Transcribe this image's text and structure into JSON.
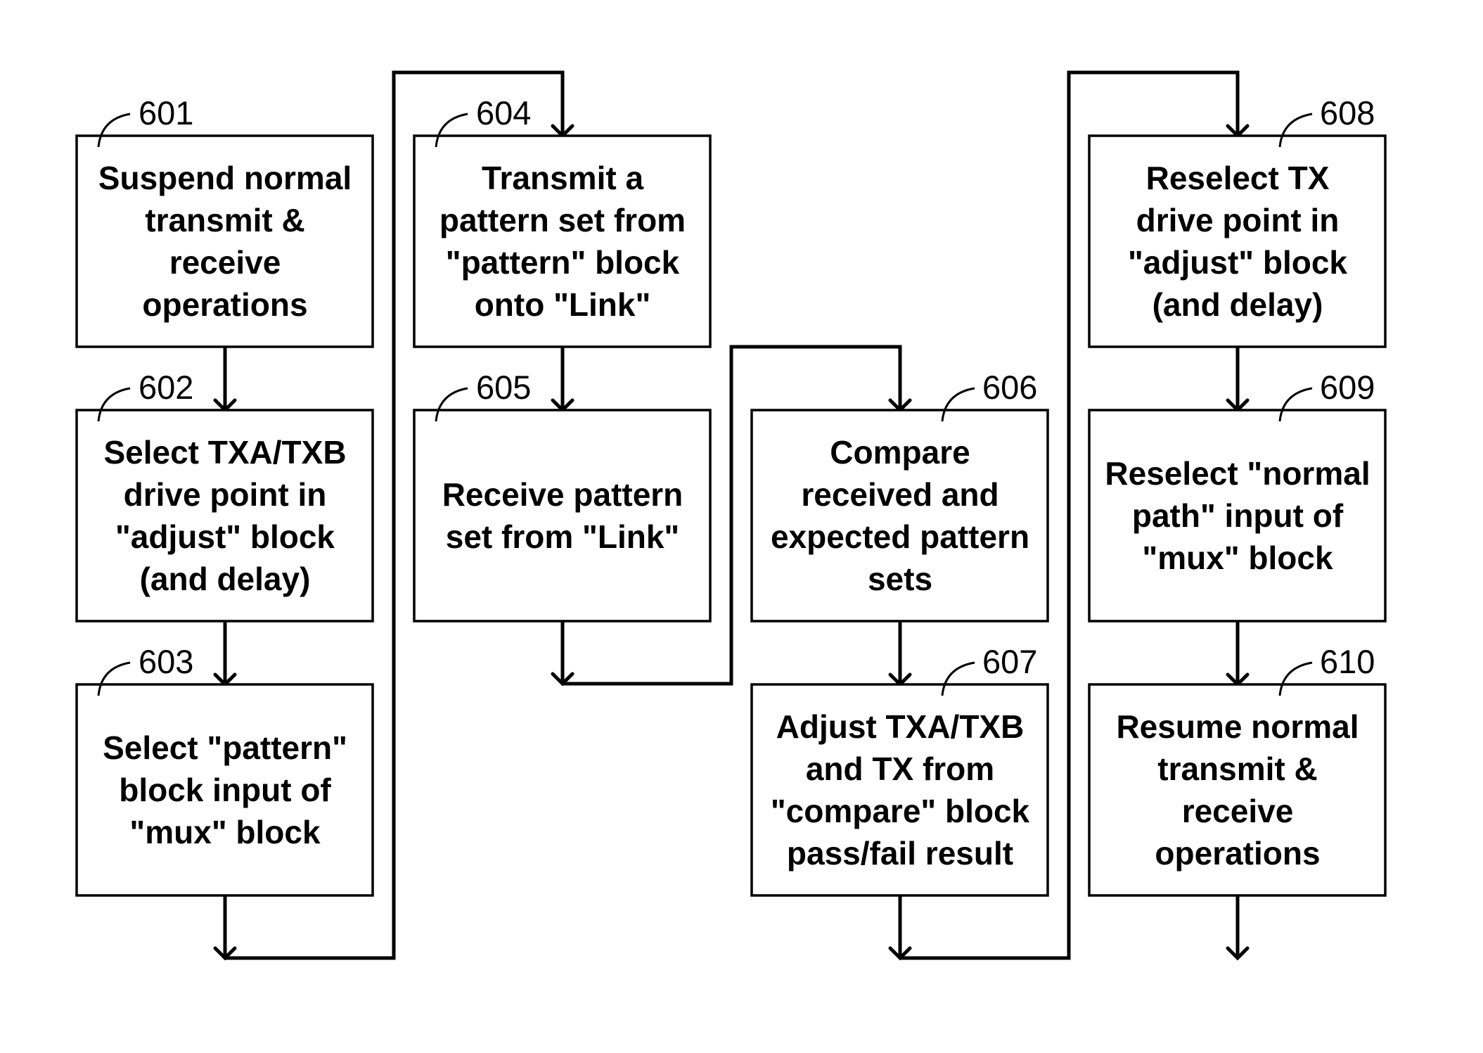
{
  "diagram": {
    "type": "flowchart",
    "steps": [
      {
        "id": "601",
        "label": "601",
        "lines": [
          "Suspend normal",
          "transmit &",
          "receive",
          "operations"
        ]
      },
      {
        "id": "602",
        "label": "602",
        "lines": [
          "Select TXA/TXB",
          "drive point in",
          "\"adjust\" block",
          "(and delay)"
        ]
      },
      {
        "id": "603",
        "label": "603",
        "lines": [
          "Select \"pattern\"",
          "block input of",
          "\"mux\" block"
        ]
      },
      {
        "id": "604",
        "label": "604",
        "lines": [
          "Transmit a",
          "pattern set from",
          "\"pattern\" block",
          "onto \"Link\""
        ]
      },
      {
        "id": "605",
        "label": "605",
        "lines": [
          "Receive pattern",
          "set from \"Link\""
        ]
      },
      {
        "id": "606",
        "label": "606",
        "lines": [
          "Compare",
          "received and",
          "expected pattern",
          "sets"
        ]
      },
      {
        "id": "607",
        "label": "607",
        "lines": [
          "Adjust TXA/TXB",
          "and TX from",
          "\"compare\" block",
          "pass/fail result"
        ]
      },
      {
        "id": "608",
        "label": "608",
        "lines": [
          "Reselect TX",
          "drive point in",
          "\"adjust\" block",
          "(and delay)"
        ]
      },
      {
        "id": "609",
        "label": "609",
        "lines": [
          "Reselect \"normal",
          "path\" input of",
          "\"mux\" block"
        ]
      },
      {
        "id": "610",
        "label": "610",
        "lines": [
          "Resume normal",
          "transmit &",
          "receive",
          "operations"
        ]
      }
    ],
    "connections": [
      {
        "from": "601",
        "to": "602"
      },
      {
        "from": "602",
        "to": "603"
      },
      {
        "from": "603",
        "to": "604"
      },
      {
        "from": "604",
        "to": "605"
      },
      {
        "from": "605",
        "to": "606"
      },
      {
        "from": "606",
        "to": "607"
      },
      {
        "from": "607",
        "to": "608"
      },
      {
        "from": "608",
        "to": "609"
      },
      {
        "from": "609",
        "to": "610"
      },
      {
        "from": "610",
        "to": null
      }
    ]
  }
}
